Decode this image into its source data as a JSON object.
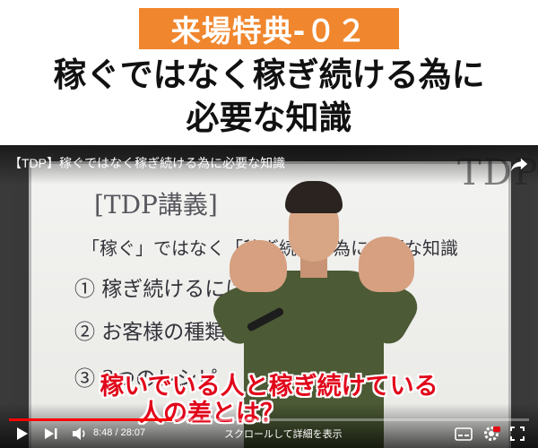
{
  "header": {
    "badge": "来場特典-０２",
    "headline_line1": "稼ぐではなく稼ぎ続ける為に",
    "headline_line2": "必要な知識"
  },
  "player": {
    "title": "【TDP】稼ぐではなく稼ぎ続ける為に必要な知識",
    "logo_text": "TDP",
    "whiteboard": {
      "heading": "[TDP講義]",
      "subheading": "「稼ぐ」ではなく「稼ぎ続ける為に必要な知識",
      "items": [
        "① 稼ぎ続けるには？",
        "② お客様の種類",
        "③ 3つのレシピ"
      ]
    },
    "caption_line1": "稼いでいる人と稼ぎ続けている",
    "caption_line2": "人の差とは？",
    "time_current": "8:48",
    "time_total": "28:07",
    "time_display": "8:48 / 28:07",
    "scroll_hint": "スクロールして詳細を表示",
    "progress_fraction": 0.313,
    "colors": {
      "accent": "#ff0000",
      "badge": "#f0862d",
      "caption": "#e1061a"
    },
    "icons": [
      "play-icon",
      "next-icon",
      "volume-icon",
      "share-icon",
      "subtitles-icon",
      "settings-icon",
      "fullscreen-icon"
    ]
  }
}
